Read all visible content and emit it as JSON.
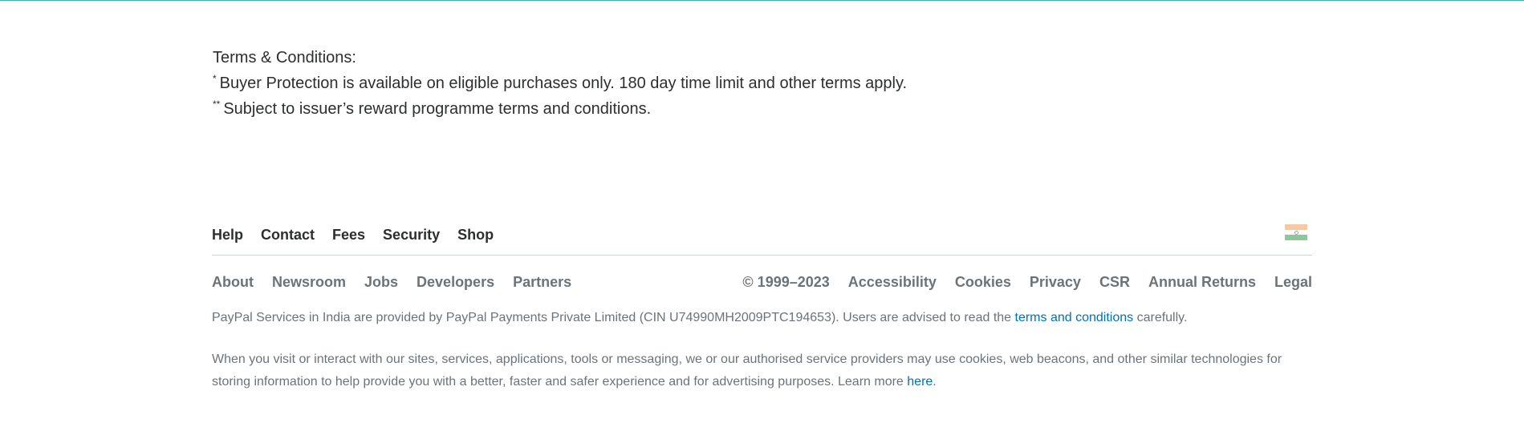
{
  "terms": {
    "heading": "Terms & Conditions:",
    "items": [
      {
        "marker": "*",
        "text": "Buyer Protection is available on eligible purchases only. 180 day time limit and other terms apply."
      },
      {
        "marker": "**",
        "text": "Subject to issuer’s reward programme terms and conditions."
      }
    ]
  },
  "footer": {
    "primary_links": [
      "Help",
      "Contact",
      "Fees",
      "Security",
      "Shop"
    ],
    "secondary_links": [
      "About",
      "Newsroom",
      "Jobs",
      "Developers",
      "Partners"
    ],
    "copyright": "© 1999–2023",
    "legal_links": [
      "Accessibility",
      "Cookies",
      "Privacy",
      "CSR",
      "Annual Returns",
      "Legal"
    ],
    "country_flag": "india-flag-icon",
    "notice": {
      "before": "PayPal Services in India are provided by PayPal Payments Private Limited (CIN U74990MH2009PTC194653). Users are advised to read the ",
      "link": "terms and conditions",
      "after": " carefully."
    },
    "cookies": {
      "before": "When you visit or interact with our sites, services, applications, tools or messaging, we or our authorised service providers may use cookies, web beacons, and other similar technologies for storing information to help provide you with a better, faster and safer experience and for advertising purposes. Learn more ",
      "link": "here",
      "after": "."
    }
  },
  "colors": {
    "accent_line": "#3bb3ae",
    "link": "#0070ba",
    "muted_text": "#6c7378",
    "body_text": "#2c2e2f"
  }
}
